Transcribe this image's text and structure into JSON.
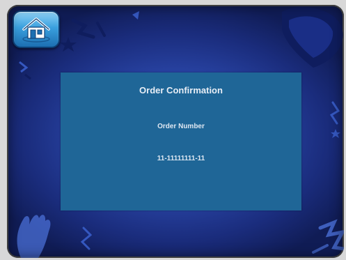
{
  "home_button": {
    "icon": "home-icon"
  },
  "confirmation": {
    "title": "Order Confirmation",
    "order_number_label": "Order Number",
    "order_number_value": "11-11111111-11"
  },
  "colors": {
    "background": "#2a46a8",
    "panel": "#1f6697",
    "text": "#e8eef6",
    "home_button": "#3aa0de"
  }
}
